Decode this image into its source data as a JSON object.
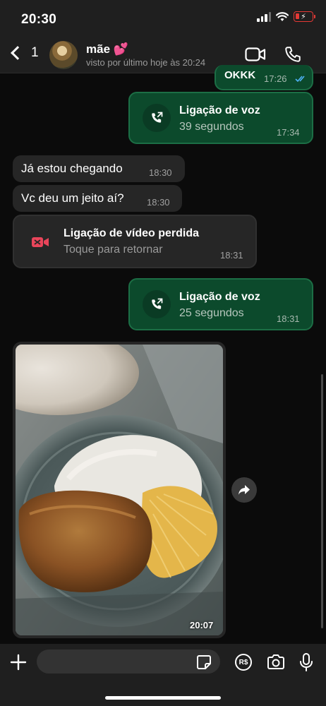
{
  "status_bar": {
    "time": "20:30"
  },
  "header": {
    "back_count": "1",
    "contact_name": "mãe 💕",
    "contact_status": "visto por último hoje às 20:24"
  },
  "messages": [
    {
      "direction": "out",
      "text": "OKKK",
      "time": "17:26",
      "read": true
    },
    {
      "direction": "out",
      "type": "voice_call",
      "title": "Ligação de voz",
      "subtitle": "39 segundos",
      "time": "17:34"
    },
    {
      "direction": "in",
      "text": "Já estou chegando",
      "time": "18:30"
    },
    {
      "direction": "in",
      "text": "Vc deu um jeito aí?",
      "time": "18:30"
    },
    {
      "direction": "in",
      "type": "missed_video_call",
      "title": "Ligação de vídeo perdida",
      "subtitle": "Toque para retornar",
      "time": "18:31"
    },
    {
      "direction": "out",
      "type": "voice_call",
      "title": "Ligação de voz",
      "subtitle": "25 segundos",
      "time": "18:31"
    },
    {
      "direction": "in",
      "type": "photo",
      "time": "20:07"
    }
  ],
  "input_bar": {
    "placeholder": ""
  },
  "colors": {
    "outgoing_bubble": "#0c4a2c",
    "incoming_bubble": "#262626",
    "missed_call": "#e8455a",
    "read_ticks": "#4fb3f6"
  },
  "icons": [
    "back-chevron-icon",
    "video-call-icon",
    "phone-icon",
    "call-outgoing-icon",
    "missed-video-icon",
    "forward-icon",
    "plus-icon",
    "sticker-icon",
    "rs-payment-icon",
    "camera-icon",
    "microphone-icon"
  ]
}
